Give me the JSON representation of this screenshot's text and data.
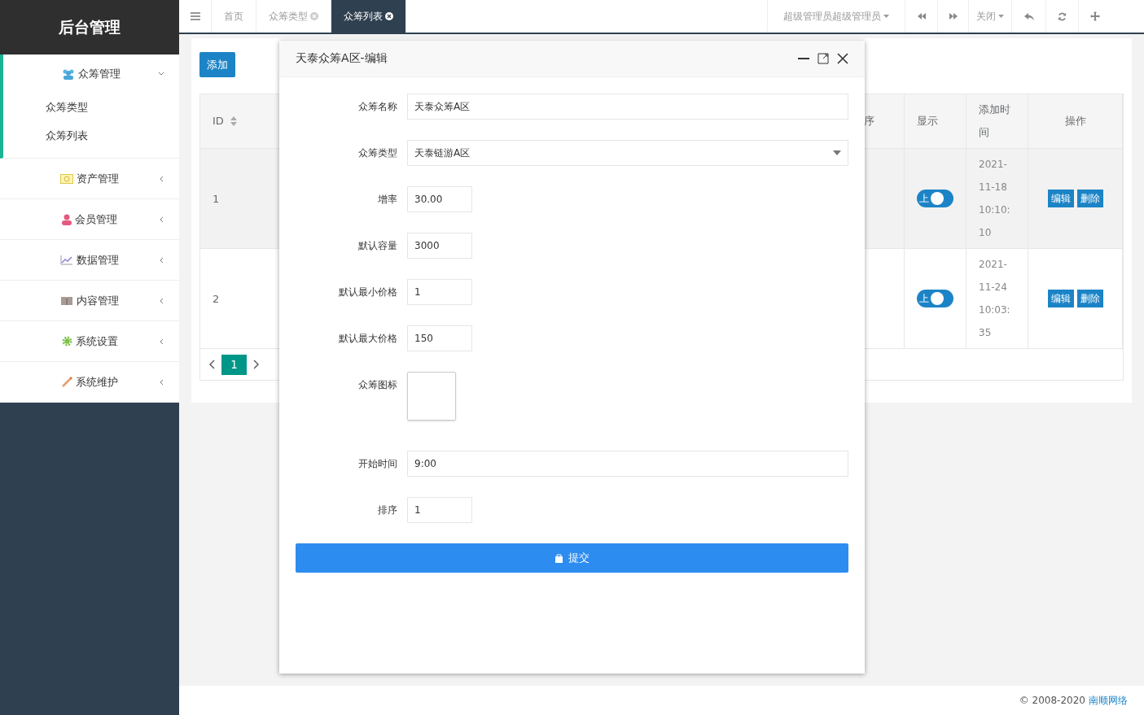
{
  "sidebar": {
    "title": "后台管理",
    "menu": [
      {
        "label": "众筹管理",
        "expanded": true,
        "children": [
          {
            "label": "众筹类型"
          },
          {
            "label": "众筹列表"
          }
        ]
      },
      {
        "label": "资产管理",
        "expanded": false
      },
      {
        "label": "会员管理",
        "expanded": false
      },
      {
        "label": "数据管理",
        "expanded": false
      },
      {
        "label": "内容管理",
        "expanded": false
      },
      {
        "label": "系统设置",
        "expanded": false
      },
      {
        "label": "系统维护",
        "expanded": false
      }
    ]
  },
  "topbar": {
    "tabs": [
      {
        "label": "首页",
        "closable": false,
        "selected": false
      },
      {
        "label": "众筹类型",
        "closable": true,
        "selected": false
      },
      {
        "label": "众筹列表",
        "closable": true,
        "selected": true
      }
    ],
    "user": "超级管理员超级管理员",
    "close_menu": "关闭"
  },
  "content": {
    "add_button": "添加",
    "table": {
      "columns": [
        "ID",
        "序",
        "显示",
        "添加时间",
        "操作"
      ],
      "rows": [
        {
          "id": "1",
          "show_label": "上",
          "on": true,
          "added": "2021-11-18 10:10:10",
          "actions": [
            "编辑",
            "删除"
          ],
          "selected": true
        },
        {
          "id": "2",
          "show_label": "上",
          "on": true,
          "added": "2021-11-24 10:03:35",
          "actions": [
            "编辑",
            "删除"
          ],
          "selected": false
        }
      ]
    },
    "pagination": [
      {
        "label": "1",
        "selected": true
      }
    ]
  },
  "modal": {
    "title": "天泰众筹A区-编辑",
    "fields": [
      {
        "label": "众筹名称",
        "kind": "text",
        "value": "天泰众筹A区"
      },
      {
        "label": "众筹类型",
        "kind": "select",
        "value": "天泰链游A区"
      },
      {
        "label": "增率",
        "kind": "short",
        "value": "30.00"
      },
      {
        "label": "默认容量",
        "kind": "short",
        "value": "3000"
      },
      {
        "label": "默认最小价格",
        "kind": "short",
        "value": "1"
      },
      {
        "label": "默认最大价格",
        "kind": "short",
        "value": "150"
      },
      {
        "label": "众筹图标",
        "kind": "image"
      },
      {
        "label": "开始时间",
        "kind": "text",
        "value": "9:00"
      },
      {
        "label": "排序",
        "kind": "short",
        "value": "1"
      }
    ],
    "submit": "提交"
  },
  "footer": {
    "copyright": "© 2008-2020",
    "link": "南顺网络"
  }
}
